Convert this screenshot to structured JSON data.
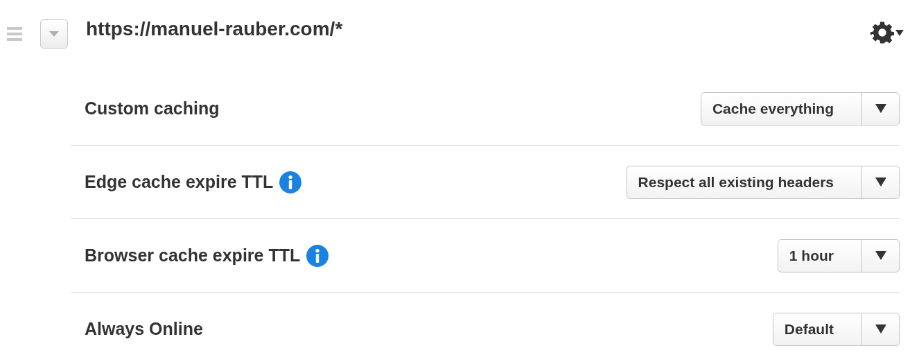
{
  "rule": {
    "pattern": "https://manuel-rauber.com/*"
  },
  "settings": [
    {
      "label": "Custom caching",
      "info": false,
      "value": "Cache everything"
    },
    {
      "label": "Edge cache expire TTL",
      "info": true,
      "value": "Respect all existing headers"
    },
    {
      "label": "Browser cache expire TTL",
      "info": true,
      "value": "1 hour"
    },
    {
      "label": "Always Online",
      "info": false,
      "value": "Default"
    }
  ]
}
